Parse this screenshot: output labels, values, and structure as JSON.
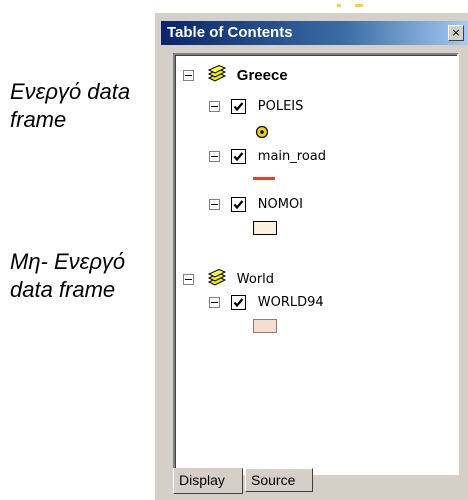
{
  "annotations": {
    "active_line1": "Ενεργό data",
    "active_line2": "frame",
    "inactive_line1": "Μη- Ενεργό",
    "inactive_line2": "data frame"
  },
  "window": {
    "title": "Table of Contents",
    "close_glyph": "×"
  },
  "tree": {
    "frames": [
      {
        "name": "Greece",
        "active": true,
        "layers": [
          {
            "name": "POLEIS",
            "checked": true,
            "symbol": "point",
            "color": "#f0d000"
          },
          {
            "name": "main_road",
            "checked": true,
            "symbol": "line",
            "color": "#e8412b"
          },
          {
            "name": "NOMOI",
            "checked": true,
            "symbol": "polygon",
            "color": "#fbf1df"
          }
        ]
      },
      {
        "name": "World",
        "active": false,
        "layers": [
          {
            "name": "WORLD94",
            "checked": true,
            "symbol": "polygon",
            "color": "#f6ddd0"
          }
        ]
      }
    ]
  },
  "tabs": {
    "display": "Display",
    "source": "Source"
  }
}
